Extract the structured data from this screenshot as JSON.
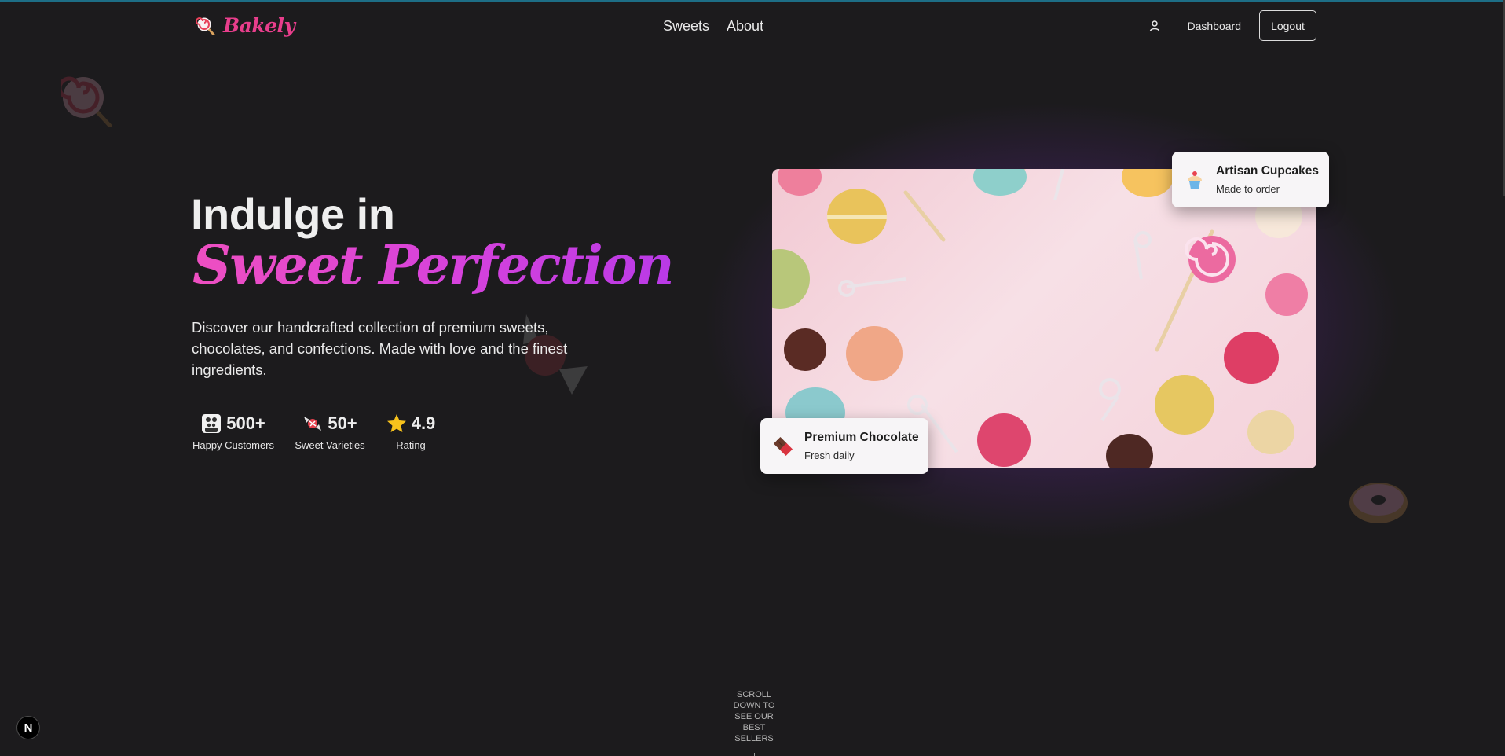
{
  "brand": {
    "name": "Bakely",
    "icon": "lollipop-icon",
    "color": "#e83e8c"
  },
  "nav": {
    "items": [
      {
        "label": "Sweets"
      },
      {
        "label": "About"
      }
    ]
  },
  "header_right": {
    "user_icon": "user-icon",
    "dashboard_label": "Dashboard",
    "logout_label": "Logout"
  },
  "hero": {
    "title_line1": "Indulge in",
    "title_line2": "Sweet Perfection",
    "description": "Discover our handcrafted collection of premium sweets, chocolates, and confections. Made with love and the finest ingredients.",
    "stats": [
      {
        "icon": "family-icon",
        "value": "500+",
        "label": "Happy Customers"
      },
      {
        "icon": "candy-icon",
        "value": "50+",
        "label": "Sweet Varieties"
      },
      {
        "icon": "star-icon",
        "value": "4.9",
        "label": "Rating"
      }
    ]
  },
  "image_cards": [
    {
      "icon": "cupcake-icon",
      "title": "Artisan Cupcakes",
      "subtitle": "Made to order"
    },
    {
      "icon": "chocolate-bar-icon",
      "title": "Premium Chocolate",
      "subtitle": "Fresh daily"
    }
  ],
  "scroll_hint": "Scroll down to see our best sellers",
  "dev_badge": "N",
  "colors": {
    "accent_pink": "#ee4fc1",
    "accent_purple": "#b93ae6",
    "background": "#1c1b1d"
  }
}
